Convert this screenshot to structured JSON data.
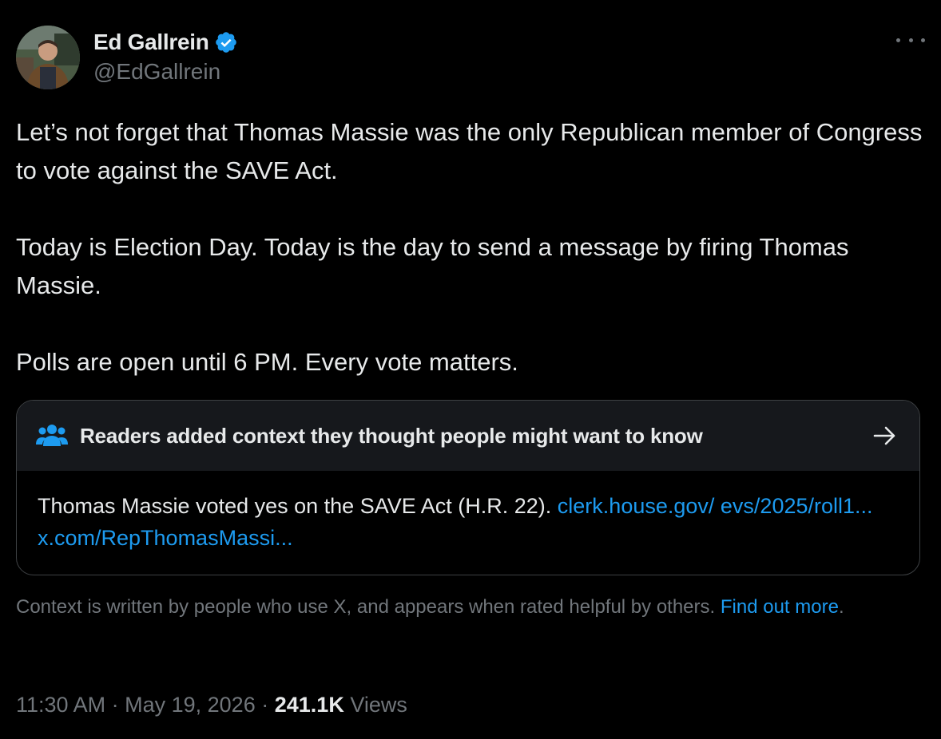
{
  "author": {
    "display_name": "Ed Gallrein",
    "handle": "@EdGallrein",
    "verified_icon": "verified-badge-icon",
    "avatar": "avatar-photo"
  },
  "more_icon": "ellipsis-icon",
  "post": {
    "paragraphs": [
      "Let’s not forget that Thomas Massie was the only Republican member of Congress to vote against the SAVE Act.",
      "Today is Election Day. Today is the day to send a message by firing Thomas Massie.",
      "Polls are open until 6 PM. Every vote matters."
    ]
  },
  "community_note": {
    "icon": "people-icon",
    "title": "Readers added context they thought people might want to know",
    "arrow_icon": "arrow-right-icon",
    "body": "Thomas Massie voted yes on the SAVE Act (H.R. 22).",
    "links": [
      "clerk.house.gov/ evs/2025/roll1...",
      "x.com/RepThomasMassi..."
    ]
  },
  "context_disclaimer": {
    "text": "Context is written by people who use X, and appears when rated helpful by others.",
    "link": "Find out more",
    "trailing": "."
  },
  "meta": {
    "time": "11:30 AM",
    "separator": "·",
    "date": "May 19, 2026",
    "views_count": "241.1K",
    "views_label": "Views"
  },
  "colors": {
    "background": "#000000",
    "text": "#e7e9ea",
    "secondary": "#71767b",
    "link": "#1d9bf0",
    "note_header": "#16181c",
    "note_border": "#3e4144"
  }
}
